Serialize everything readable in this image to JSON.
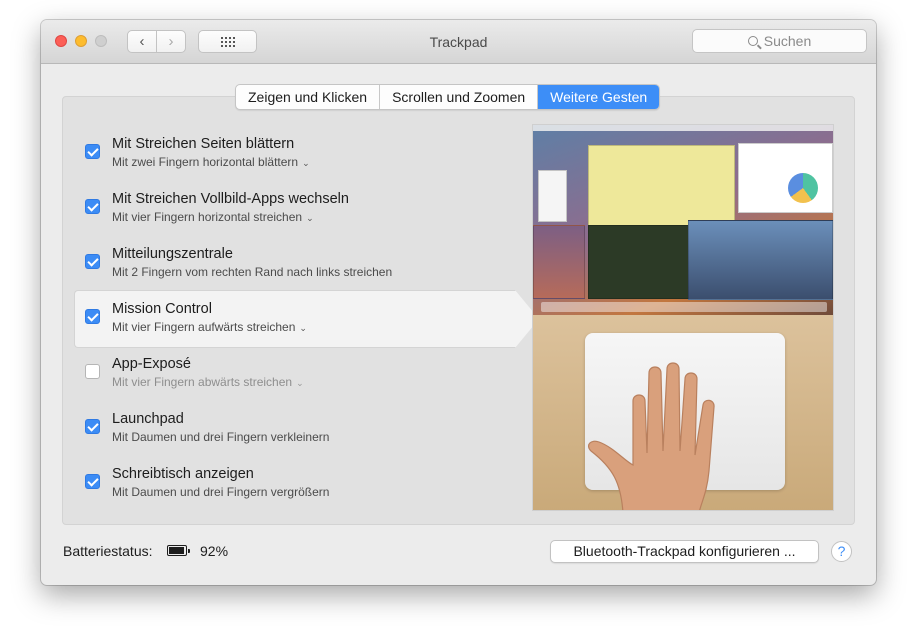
{
  "window": {
    "title": "Trackpad"
  },
  "search": {
    "placeholder": "Suchen"
  },
  "tabs": [
    {
      "label": "Zeigen und Klicken",
      "active": false
    },
    {
      "label": "Scrollen und Zoomen",
      "active": false
    },
    {
      "label": "Weitere Gesten",
      "active": true
    }
  ],
  "gestures": [
    {
      "title": "Mit Streichen Seiten blättern",
      "subtitle": "Mit zwei Fingern horizontal blättern",
      "checked": true,
      "has_menu": true
    },
    {
      "title": "Mit Streichen Vollbild-Apps wechseln",
      "subtitle": "Mit vier Fingern horizontal streichen",
      "checked": true,
      "has_menu": true
    },
    {
      "title": "Mitteilungszentrale",
      "subtitle": "Mit 2 Fingern vom rechten Rand nach links streichen",
      "checked": true,
      "has_menu": false
    },
    {
      "title": "Mission Control",
      "subtitle": "Mit vier Fingern aufwärts streichen",
      "checked": true,
      "has_menu": true,
      "selected": true
    },
    {
      "title": "App-Exposé",
      "subtitle": "Mit vier Fingern abwärts streichen",
      "checked": false,
      "has_menu": true
    },
    {
      "title": "Launchpad",
      "subtitle": "Mit Daumen und drei Fingern verkleinern",
      "checked": true,
      "has_menu": false
    },
    {
      "title": "Schreibtisch anzeigen",
      "subtitle": "Mit Daumen und drei Fingern vergrößern",
      "checked": true,
      "has_menu": false
    }
  ],
  "footer": {
    "battery_label": "Batteriestatus:",
    "battery_value": "92%",
    "battery_level": 0.92,
    "configure_button": "Bluetooth-Trackpad konfigurieren ...",
    "help_label": "?"
  },
  "colors": {
    "accent": "#3d8ef7",
    "checkbox": "#3c8cf5"
  },
  "icons": [
    "close-icon",
    "minimize-icon",
    "zoom-icon",
    "chevron-left-icon",
    "chevron-right-icon",
    "grid-icon",
    "search-icon",
    "chevron-down-icon",
    "battery-icon",
    "help-icon"
  ]
}
